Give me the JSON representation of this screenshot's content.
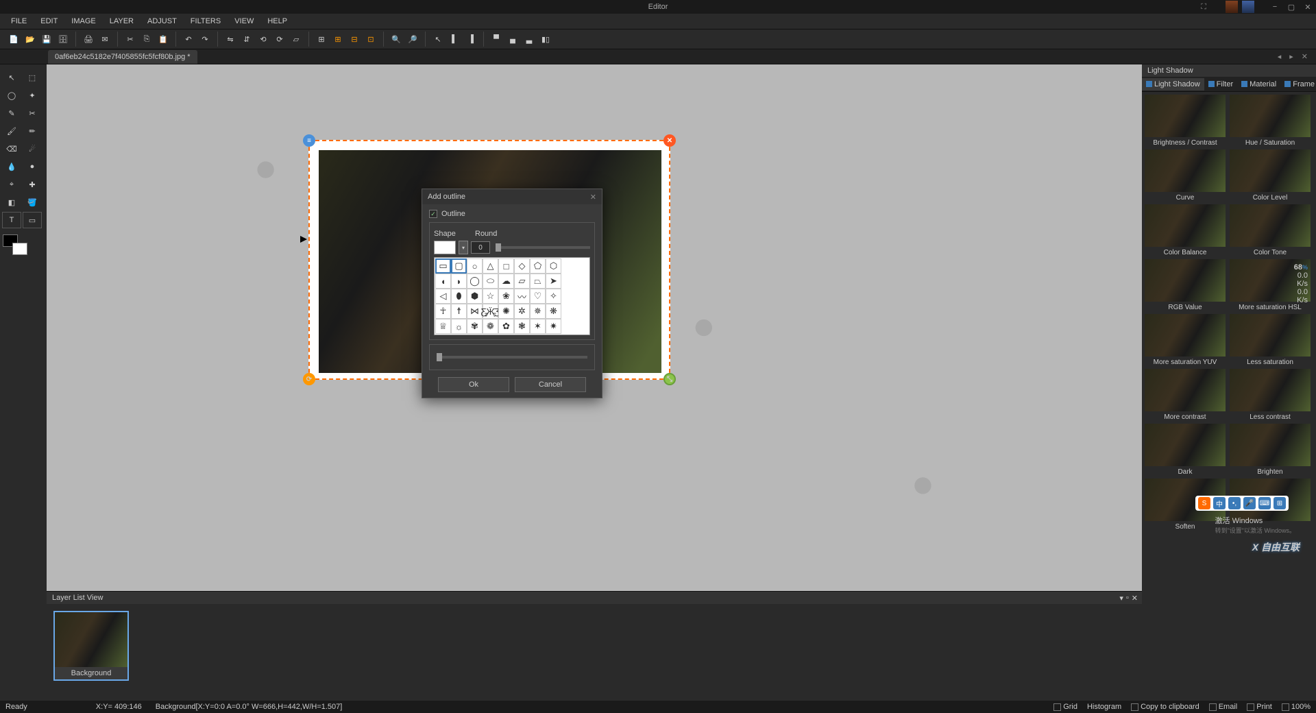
{
  "app": {
    "title": "Editor"
  },
  "menubar": [
    "FILE",
    "EDIT",
    "IMAGE",
    "LAYER",
    "ADJUST",
    "FILTERS",
    "VIEW",
    "HELP"
  ],
  "doctab": "0af6eb24c5182e7f405855fc5fcf80b.jpg *",
  "layerpanel": {
    "title": "Layer List View",
    "thumb_name": "Background"
  },
  "rightpanel": {
    "title": "Light Shadow",
    "tabs": [
      "Light Shadow",
      "Filter",
      "Material",
      "Frame"
    ],
    "effects": [
      [
        "Brightness / Contrast",
        "Hue / Saturation"
      ],
      [
        "Curve",
        "Color Level"
      ],
      [
        "Color Balance",
        "Color Tone"
      ],
      [
        "RGB Value",
        "More saturation HSL"
      ],
      [
        "More saturation YUV",
        "Less saturation"
      ],
      [
        "More contrast",
        "Less contrast"
      ],
      [
        "Dark",
        "Brighten"
      ],
      [
        "Soften",
        ""
      ]
    ]
  },
  "dialog": {
    "title": "Add outline",
    "outline_label": "Outline",
    "shape_label": "Shape",
    "round_label": "Round",
    "round_value": "0",
    "ok": "Ok",
    "cancel": "Cancel"
  },
  "statusbar": {
    "ready": "Ready",
    "coords": "X:Y= 409:146",
    "layerinfo": "Background[X:Y=0:0 A=0.0° W=666,H=442,W/H=1.507]",
    "items": [
      "Grid",
      "Histogram",
      "Copy to clipboard",
      "Email",
      "Print",
      "100%"
    ]
  },
  "speed": {
    "value": "68",
    "unit": "%",
    "rate1": "0.0",
    "rate1u": "K/s",
    "rate2": "0.0",
    "rate2u": "K/s"
  },
  "watermark": {
    "line1": "激活 Windows",
    "line2": "转到\"设置\"以激活 Windows。"
  },
  "brand": "X 自由互联"
}
